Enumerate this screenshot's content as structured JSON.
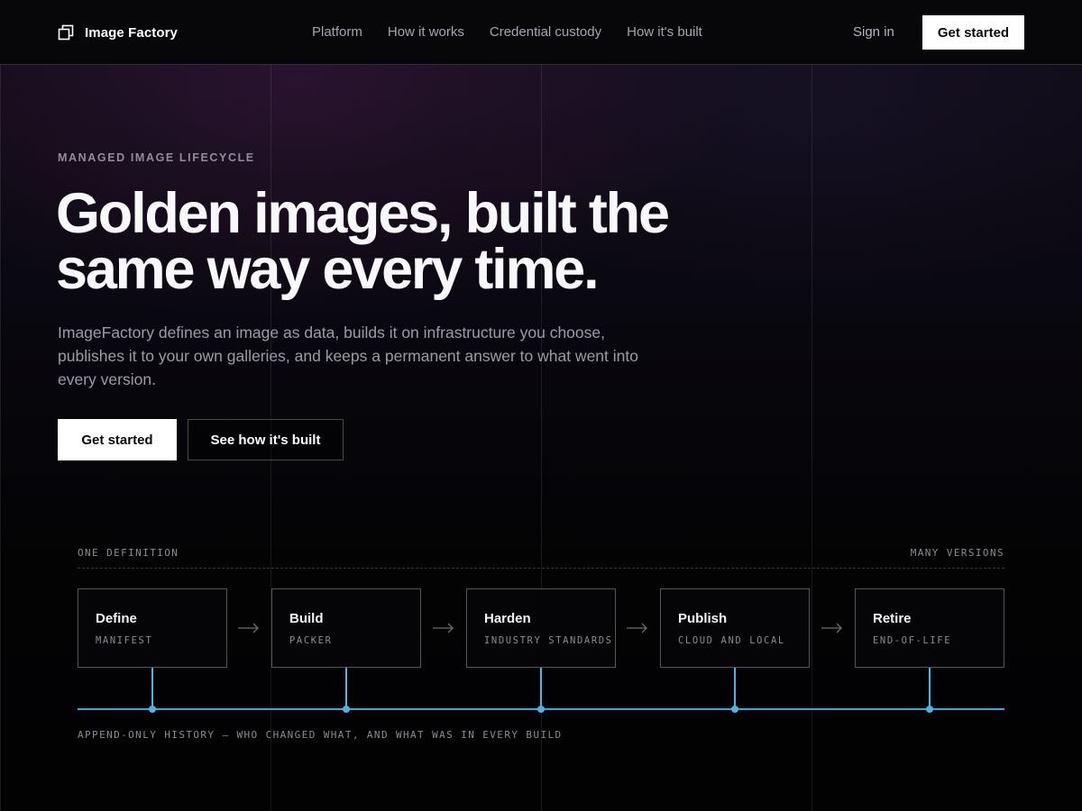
{
  "nav": {
    "brand": "Image Factory",
    "brand_icon": "stacked-squares-icon",
    "links": [
      "Platform",
      "How it works",
      "Credential custody",
      "How it's built"
    ],
    "signin": "Sign in",
    "cta": "Get started"
  },
  "hero": {
    "eyebrow": "MANAGED IMAGE LIFECYCLE",
    "headline_line1": "Golden images, built the",
    "headline_line2": "same way every time.",
    "lede": "ImageFactory defines an image as data, builds it on infrastructure you choose, publishes it to your own galleries, and keeps a permanent answer to what went into every version.",
    "primary_cta": "Get started",
    "secondary_cta": "See how it's built"
  },
  "pipeline": {
    "left_label": "One definition",
    "right_label": "Many versions",
    "stages": [
      {
        "title": "Define",
        "sub": "Manifest"
      },
      {
        "title": "Build",
        "sub": "Packer"
      },
      {
        "title": "Harden",
        "sub": "Industry standards"
      },
      {
        "title": "Publish",
        "sub": "Cloud and local"
      },
      {
        "title": "Retire",
        "sub": "End-of-life"
      }
    ],
    "history_label": "Append-only history — who changed what, and what was in every build",
    "arrow_icon": "arrow-right-icon",
    "accent_color": "#46b6e8"
  },
  "colors": {
    "background": "#040406",
    "accent": "#46b6e8",
    "primary_button": "#ffffff"
  }
}
